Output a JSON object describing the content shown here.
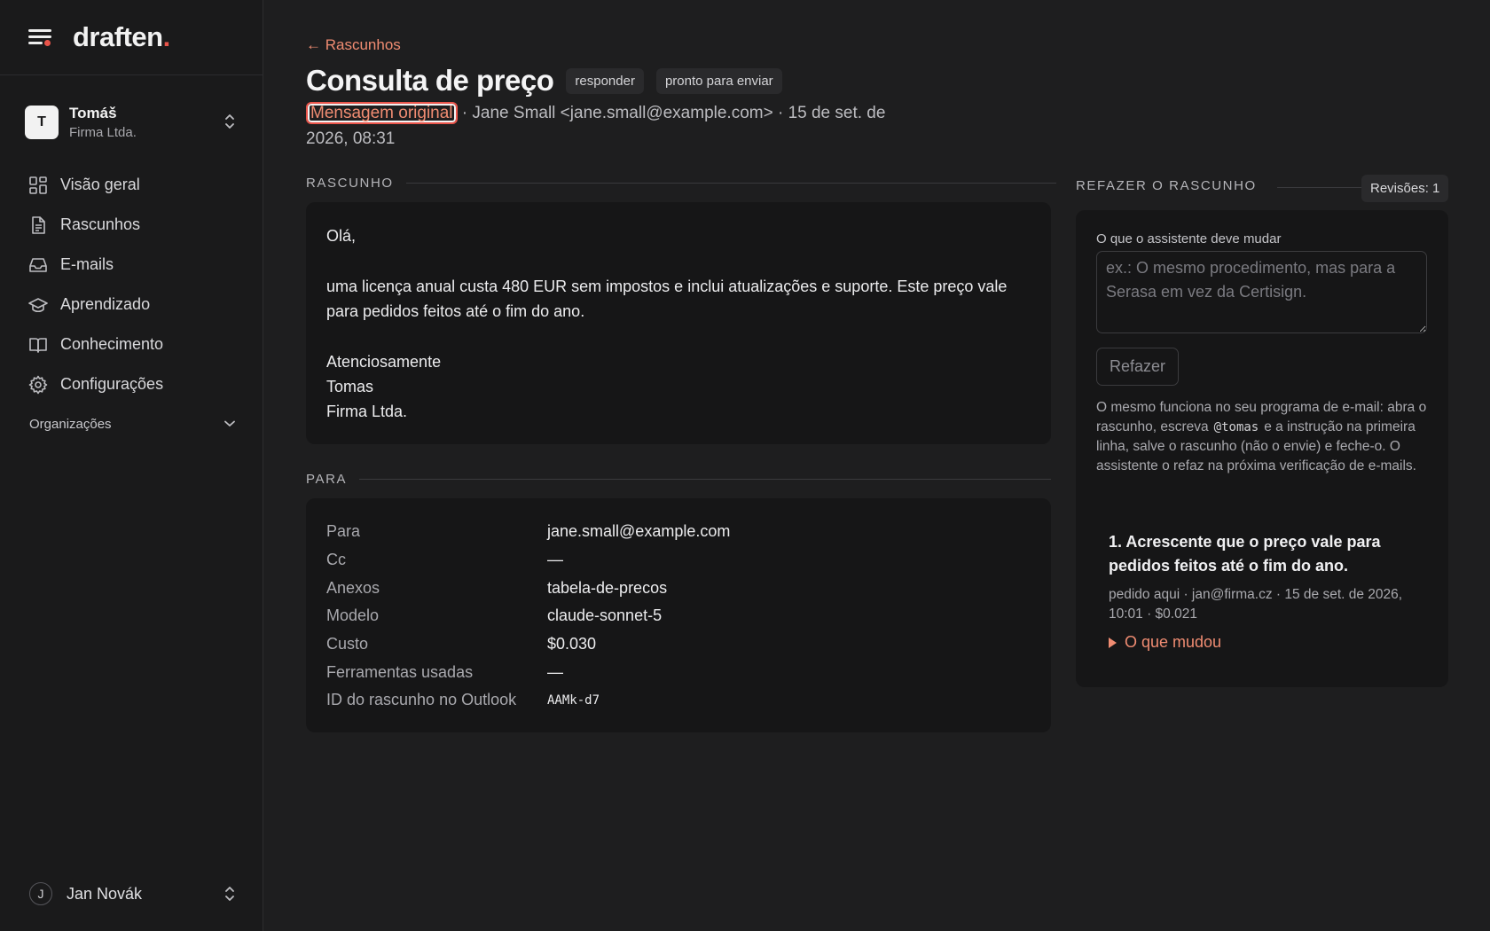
{
  "brand": {
    "name": "draften",
    "dot": "."
  },
  "account": {
    "initial": "T",
    "name": "Tomáš",
    "org": "Firma Ltda."
  },
  "nav": [
    {
      "label": "Visão geral",
      "icon": "dashboard-icon"
    },
    {
      "label": "Rascunhos",
      "icon": "document-icon"
    },
    {
      "label": "E-mails",
      "icon": "inbox-icon"
    },
    {
      "label": "Aprendizado",
      "icon": "graduation-cap-icon"
    },
    {
      "label": "Conhecimento",
      "icon": "book-icon"
    },
    {
      "label": "Configurações",
      "icon": "gear-icon"
    }
  ],
  "organizations_label": "Organizações",
  "user": {
    "initial": "J",
    "name": "Jan Novák"
  },
  "header": {
    "back": "← Rascunhos",
    "title": "Consulta de preço",
    "tags": [
      "responder",
      "pronto para enviar"
    ],
    "original_link": "Mensagem original",
    "meta_rest": " · Jane Small <jane.small@example.com> · 15 de set. de 2026, 08:31"
  },
  "draft": {
    "label": "RASCUNHO",
    "greeting": "Olá,",
    "body": "uma licença anual custa 480 EUR sem impostos e inclui atualizações e suporte. Este preço vale para pedidos feitos até o fim do ano.",
    "closing": "Atenciosamente",
    "signature_name": "Tomas",
    "signature_company": "Firma Ltda."
  },
  "para": {
    "label": "PARA",
    "rows": [
      {
        "key": "Para",
        "value": "jane.small@example.com"
      },
      {
        "key": "Cc",
        "value": "—"
      },
      {
        "key": "Anexos",
        "value": "tabela-de-precos"
      },
      {
        "key": "Modelo",
        "value": "claude-sonnet-5"
      },
      {
        "key": "Custo",
        "value": "$0.030"
      },
      {
        "key": "Ferramentas usadas",
        "value": "—"
      },
      {
        "key": "ID do rascunho no Outlook",
        "value": "AAMk-d7"
      }
    ]
  },
  "redo": {
    "label": "REFAZER O RASCUNHO",
    "revisions": "Revisões: 1",
    "field_label": "O que o assistente deve mudar",
    "placeholder": "ex.: O mesmo procedimento, mas para a Serasa em vez da Certisign.",
    "value": "",
    "button": "Refazer",
    "help_before": "O mesmo funciona no seu programa de e-mail: abra o rascunho, escreva",
    "help_code": "@tomas",
    "help_after": "e a instrução na primeira linha, salve o rascunho (não o envie) e feche-o. O assistente o refaz na próxima verificação de e-mails.",
    "item": {
      "title": "1. Acrescente que o preço vale para pedidos feitos até o fim do ano.",
      "meta": "pedido aqui · jan@firma.cz · 15 de set. de 2026, 10:01 · $0.021",
      "toggle": "O que mudou"
    }
  },
  "colors": {
    "accent": "#e8544a",
    "link": "#f08c72",
    "background": "#1e1e1f",
    "card": "#161617"
  }
}
